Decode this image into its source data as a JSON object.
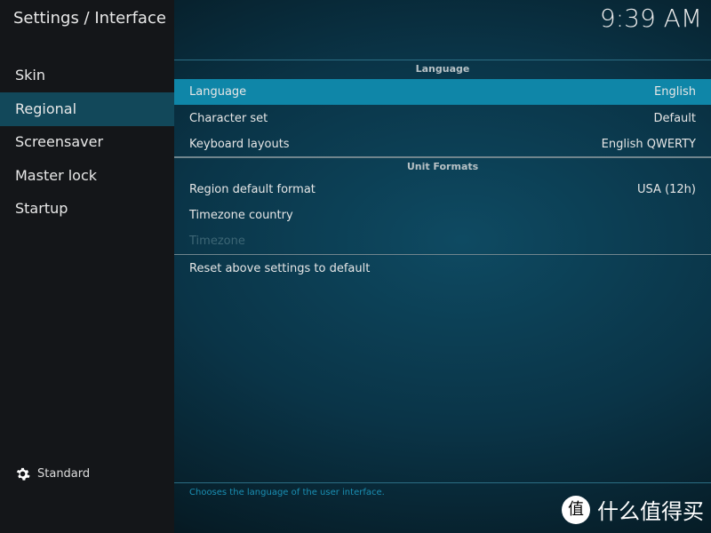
{
  "header": {
    "title": "Settings / Interface",
    "clock": "9:39 AM"
  },
  "sidebar": {
    "items": [
      {
        "label": "Skin"
      },
      {
        "label": "Regional",
        "active": true
      },
      {
        "label": "Screensaver"
      },
      {
        "label": "Master lock"
      },
      {
        "label": "Startup"
      }
    ],
    "profile_level": "Standard",
    "profile_icon": "gear-icon"
  },
  "main": {
    "sections": [
      {
        "title": "Language"
      },
      {
        "title": "Unit Formats"
      }
    ],
    "rows": [
      {
        "label": "Language",
        "value": "English"
      },
      {
        "label": "Character set",
        "value": "Default"
      },
      {
        "label": "Keyboard layouts",
        "value": "English QWERTY"
      },
      {
        "label": "Region default format",
        "value": "USA (12h)"
      },
      {
        "label": "Timezone country",
        "value": ""
      },
      {
        "label": "Timezone",
        "value": ""
      },
      {
        "label": "Reset above settings to default",
        "value": ""
      }
    ],
    "help": "Chooses the language of the user interface."
  },
  "watermark": {
    "glyph": "值",
    "text": "什么值得买"
  },
  "colors": {
    "accent": "#0f86a8",
    "sidebar_active": "#12485a"
  }
}
